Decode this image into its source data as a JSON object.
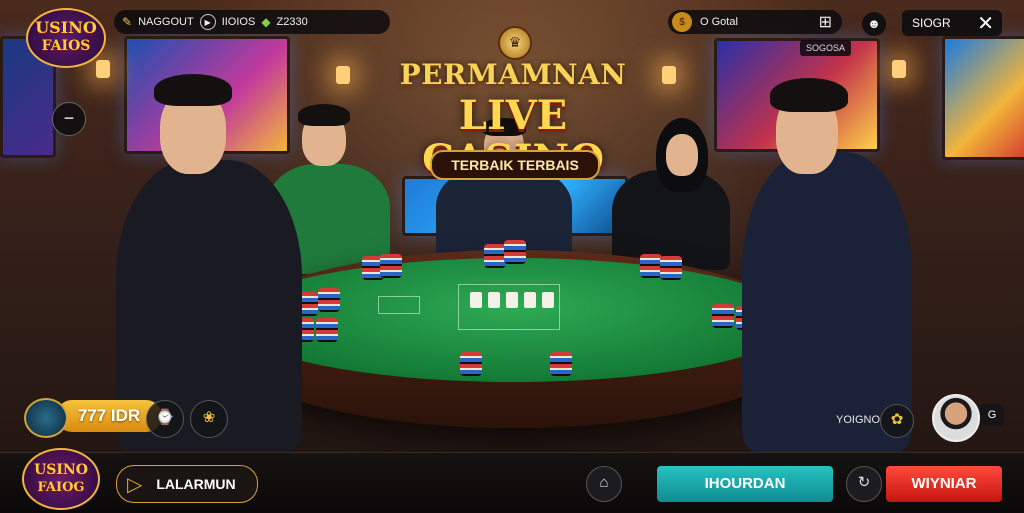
{
  "brand": {
    "line1": "USINO",
    "line2": "FAIOS"
  },
  "top_left_bar": {
    "item1": "NAGGOUT",
    "item2": "IIOIOS",
    "item3": "Z2330"
  },
  "top_right_bar": {
    "label": "O Gotal"
  },
  "sub_badge": "SOGOSA",
  "close_box": {
    "label": "SIOGR",
    "close": "✕"
  },
  "title": {
    "line1": "PERMAMNAN",
    "line2": "LIVE CASINO",
    "ribbon": "TERBAIK TERBAIS"
  },
  "balance": {
    "amount": "777 IDR"
  },
  "live_label": "YOIGNO",
  "avatar_badge": "G",
  "bottom_logo": {
    "line1": "USINO",
    "line2": "FAIOG"
  },
  "lang_button": {
    "label": "LALARMUN"
  },
  "buttons": {
    "primary": "IHOURDAN",
    "secondary": "WIYNIAR"
  },
  "icons": {
    "side_button": "minus-icon",
    "wallet": "wallet-icon",
    "gift": "gift-icon",
    "grid": "grid-icon",
    "mask": "mask-icon",
    "history": "history-icon",
    "refresh": "refresh-icon"
  },
  "colors": {
    "accent_gold": "#f2b53a",
    "primary_button": "#1aa9ac",
    "secondary_button": "#e3261b",
    "felt": "#1e8f40"
  }
}
